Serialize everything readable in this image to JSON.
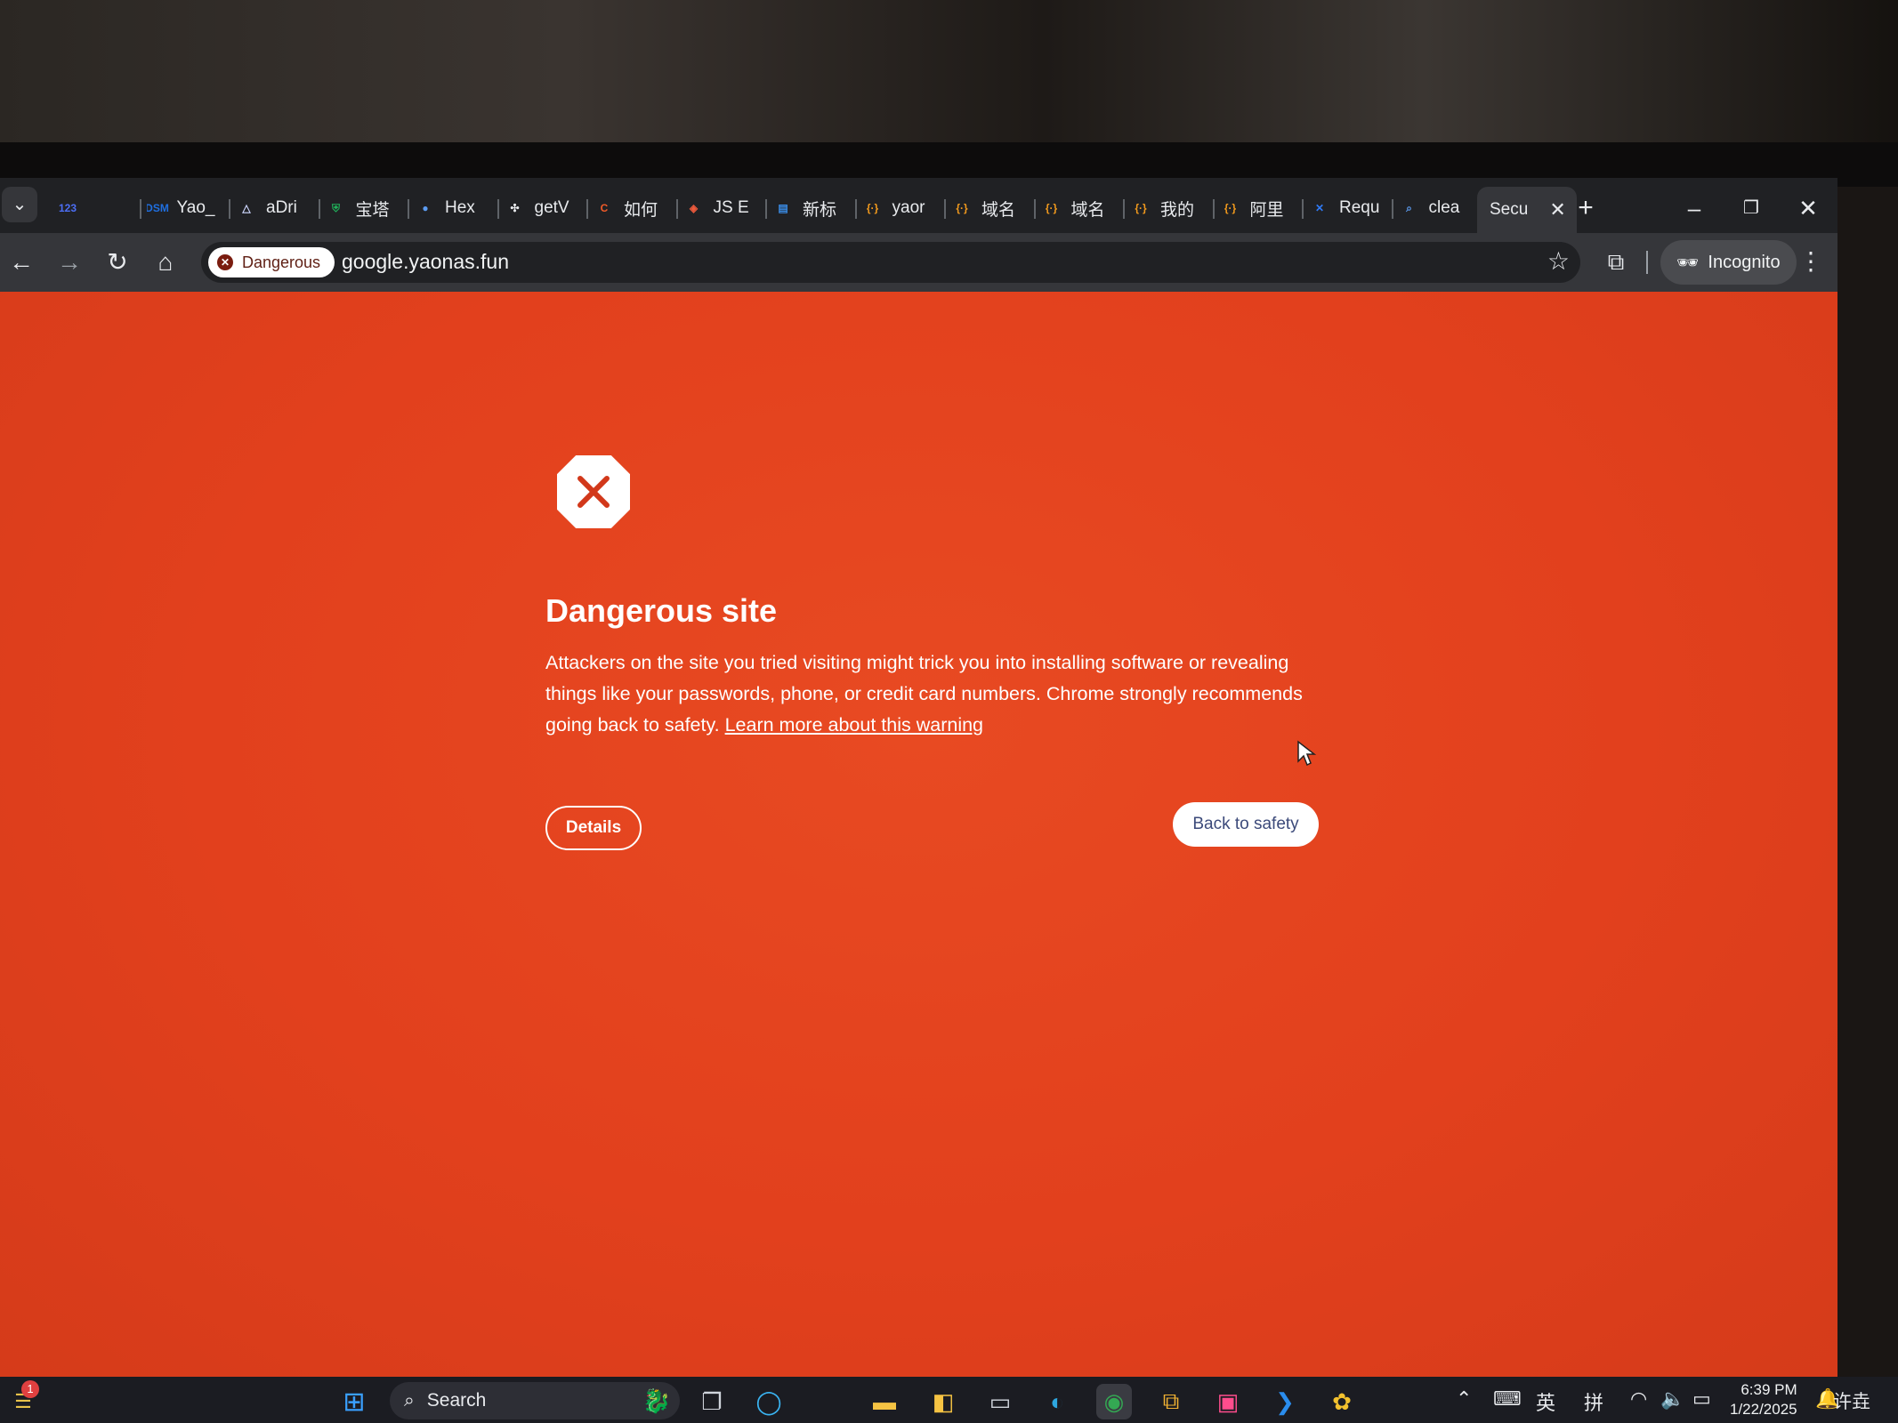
{
  "browser": {
    "tabs": [
      {
        "label": "",
        "icon": "123-icon",
        "color": "#4c6ef5"
      },
      {
        "label": "Yao_",
        "icon": "dsm-icon",
        "color": "#1f6fe0"
      },
      {
        "label": "aDri",
        "icon": "adrive-icon",
        "color": "#cfd8ff"
      },
      {
        "label": "宝塔",
        "icon": "shield-icon",
        "color": "#20b15a"
      },
      {
        "label": "Hex",
        "icon": "globe-icon",
        "color": "#5c9cf2"
      },
      {
        "label": "getV",
        "icon": "hash-icon",
        "color": "#e8eaed"
      },
      {
        "label": "如何",
        "icon": "c-icon",
        "color": "#f05a28"
      },
      {
        "label": "JS E",
        "icon": "cube-icon",
        "color": "#ef5a3c"
      },
      {
        "label": "新标",
        "icon": "doc-icon",
        "color": "#3a8de8"
      },
      {
        "label": "yaor",
        "icon": "bracket-icon",
        "color": "#f29a1d"
      },
      {
        "label": "域名",
        "icon": "bracket-icon",
        "color": "#f29a1d"
      },
      {
        "label": "域名",
        "icon": "bracket-icon",
        "color": "#f29a1d"
      },
      {
        "label": "我的",
        "icon": "bracket-icon",
        "color": "#f29a1d"
      },
      {
        "label": "阿里",
        "icon": "bracket-icon",
        "color": "#f29a1d"
      },
      {
        "label": "Requ",
        "icon": "x-icon",
        "color": "#2f7af6"
      },
      {
        "label": "clea",
        "icon": "search-icon",
        "color": "#5c9cf2"
      }
    ],
    "active_tab": {
      "label": "Secu"
    },
    "security_chip": "Dangerous",
    "url": "google.yaonas.fun",
    "incognito_label": "Incognito"
  },
  "interstitial": {
    "title": "Dangerous site",
    "body": "Attackers on the site you tried visiting might trick you into installing software or revealing things like your passwords, phone, or credit card numbers. Chrome strongly recommends going back to safety. ",
    "learn_more": "Learn more about this warning",
    "details_button": "Details",
    "back_button": "Back to safety",
    "background_color": "#e2401d"
  },
  "taskbar": {
    "search_label": "Search",
    "notification_count": "1",
    "ime_lang": "英",
    "ime_mode": "拼",
    "time": "6:39 PM",
    "date": "1/22/2025",
    "user_tag": "许垚"
  }
}
